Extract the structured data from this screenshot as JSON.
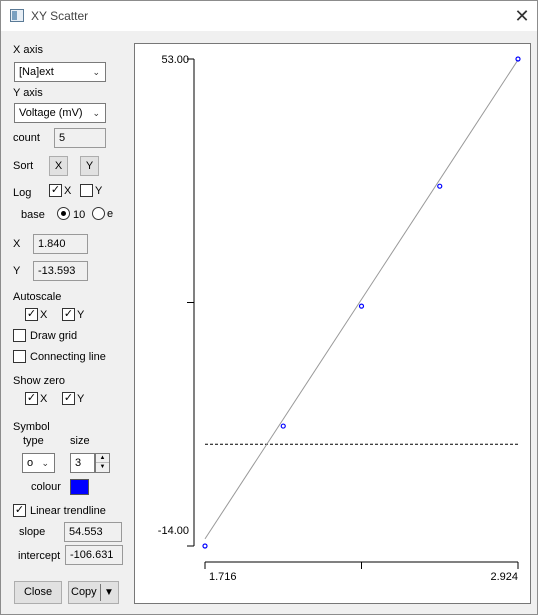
{
  "window": {
    "title": "XY Scatter",
    "close_glyph": "✕"
  },
  "controls": {
    "x_axis_label": "X axis",
    "x_axis_value": "[Na]ext",
    "y_axis_label": "Y axis",
    "y_axis_value": "Voltage (mV)",
    "count_label": "count",
    "count_value": "5",
    "sort_label": "Sort",
    "sort_x": "X",
    "sort_y": "Y",
    "log_label": "Log",
    "log_x_label": "X",
    "log_x_checked": true,
    "log_y_label": "Y",
    "log_y_checked": false,
    "base_label": "base",
    "base_10_label": "10",
    "base_e_label": "e",
    "base_selected": "10",
    "cursor_x_label": "X",
    "cursor_x_value": "1.840",
    "cursor_y_label": "Y",
    "cursor_y_value": "-13.593",
    "autoscale_label": "Autoscale",
    "autoscale_x_label": "X",
    "autoscale_x_checked": true,
    "autoscale_y_label": "Y",
    "autoscale_y_checked": true,
    "draw_grid_label": "Draw grid",
    "draw_grid_checked": false,
    "connecting_line_label": "Connecting line",
    "connecting_line_checked": false,
    "show_zero_label": "Show zero",
    "show_zero_x_label": "X",
    "show_zero_x_checked": true,
    "show_zero_y_label": "Y",
    "show_zero_y_checked": true,
    "symbol_label": "Symbol",
    "type_label": "type",
    "type_value": "o",
    "size_label": "size",
    "size_value": "3",
    "colour_label": "colour",
    "colour_value": "#0000ff",
    "trendline_label": "Linear trendline",
    "trendline_checked": true,
    "slope_label": "slope",
    "slope_value": "54.553",
    "intercept_label": "intercept",
    "intercept_value": "-106.631",
    "close_button": "Close",
    "copy_button": "Copy",
    "check_glyph": "✓",
    "dropdown_glyph": "▼"
  },
  "chart_data": {
    "type": "scatter",
    "xlim": [
      1.716,
      2.924
    ],
    "ylim": [
      -14.0,
      53.0
    ],
    "x_tick_labels": [
      "1.716",
      "2.924"
    ],
    "y_tick_labels": [
      "53.00",
      "-14.00"
    ],
    "x": [
      1.716,
      2.018,
      2.32,
      2.622,
      2.924
    ],
    "y": [
      -14.0,
      2.5,
      19.0,
      35.5,
      53.0
    ],
    "trendline": {
      "slope": 54.553,
      "intercept": -106.631
    },
    "zero_line_y": 0,
    "marker_color": "#0000ff",
    "grid": false,
    "connecting_line": false
  }
}
